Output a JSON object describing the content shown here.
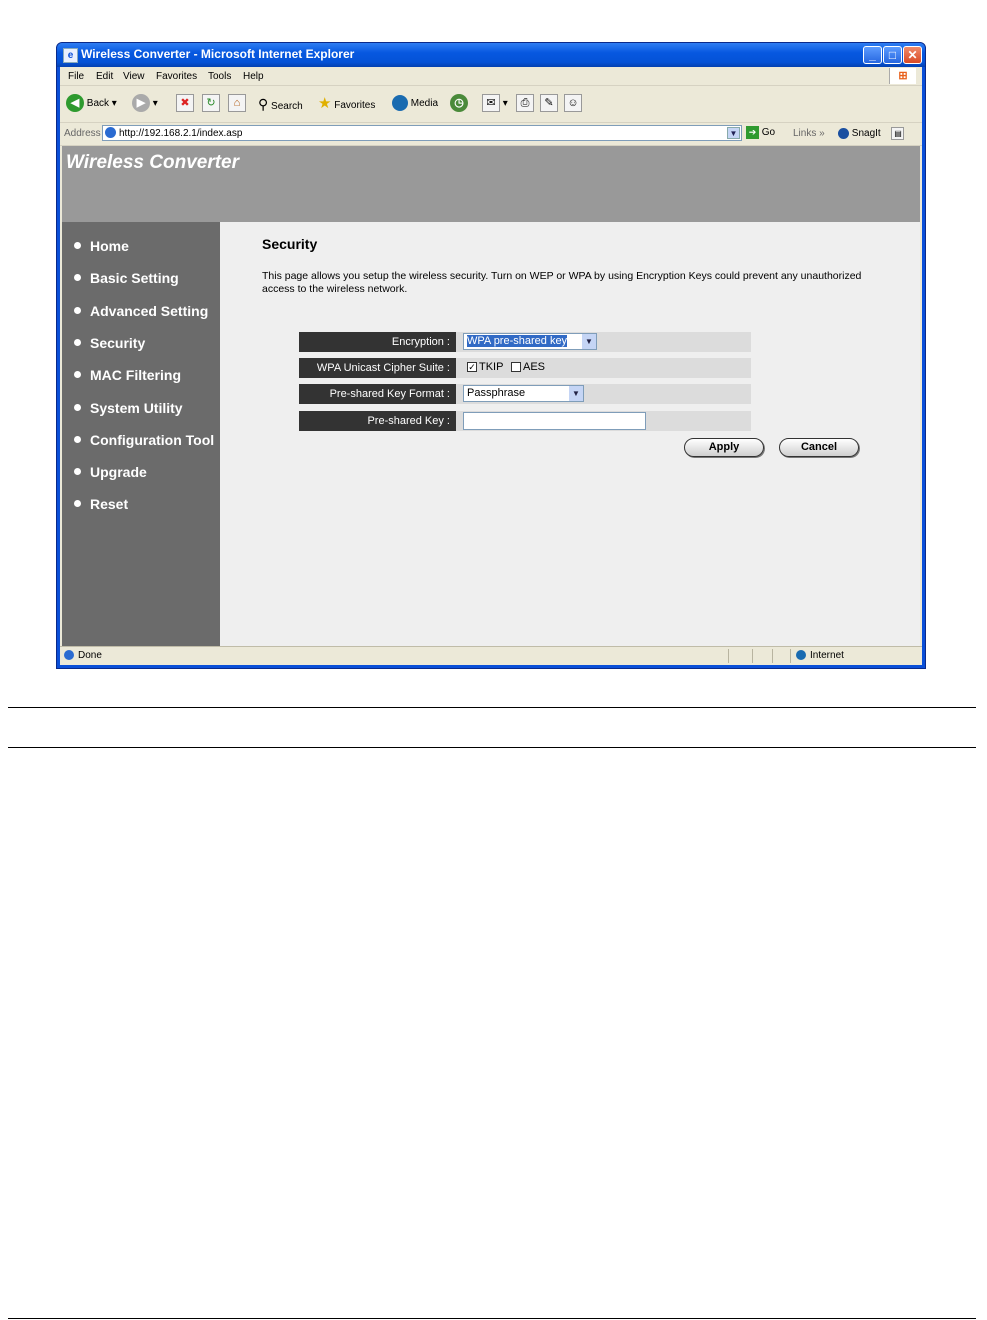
{
  "window": {
    "title": "Wireless Converter - Microsoft Internet Explorer",
    "minimize_glyph": "_",
    "maximize_glyph": "□",
    "close_glyph": "✕"
  },
  "menu": [
    "File",
    "Edit",
    "View",
    "Favorites",
    "Tools",
    "Help"
  ],
  "toolbar": {
    "back": "Back",
    "search": "Search",
    "favorites": "Favorites",
    "media": "Media"
  },
  "address": {
    "label": "Address",
    "url": "http://192.168.2.1/index.asp",
    "go": "Go",
    "links": "Links",
    "snagit": "SnagIt"
  },
  "page": {
    "banner_title": "Wireless Converter",
    "nav": [
      "Home",
      "Basic Setting",
      "Advanced Setting",
      "Security",
      "MAC Filtering",
      "System Utility",
      "Configuration Tool",
      "Upgrade",
      "Reset"
    ],
    "title": "Security",
    "description": "This page allows you setup the wireless security. Turn on WEP or WPA by using Encryption Keys could prevent any unauthorized access to the wireless network.",
    "form": {
      "encryption_label": "Encryption :",
      "encryption_value": "WPA pre-shared key",
      "cipher_label": "WPA Unicast Cipher Suite :",
      "tkip_label": "TKIP",
      "tkip_checked": true,
      "aes_label": "AES",
      "aes_checked": false,
      "format_label": "Pre-shared Key Format :",
      "format_value": "Passphrase",
      "key_label": "Pre-shared Key :",
      "key_value": ""
    },
    "apply": "Apply",
    "cancel": "Cancel"
  },
  "status": {
    "text": "Done",
    "zone": "Internet"
  }
}
